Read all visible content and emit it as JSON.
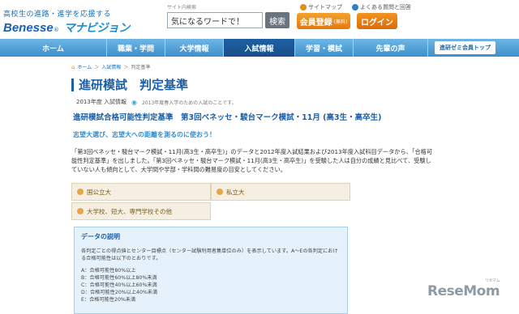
{
  "header": {
    "tagline": "高校生の進路・進学を応援する",
    "logo_benesse": "Benesse",
    "logo_reg": "®",
    "logo_manavi": "マナビジョン",
    "search_label": "サイト内検索",
    "search_value": "気になるワードで！",
    "search_button": "検索",
    "link_sitemap": "サイトマップ",
    "link_faq": "よくある質問と回答",
    "register_button": "会員登録",
    "register_note": "(無料)",
    "login_button": "ログイン"
  },
  "nav": {
    "items": [
      {
        "label": "ホーム"
      },
      {
        "label": "職業・学問"
      },
      {
        "label": "大学情報"
      },
      {
        "label": "入試情報"
      },
      {
        "label": "学習・模試"
      },
      {
        "label": "先輩の声"
      }
    ],
    "active_index": 3,
    "seminar_button": "進研ゼミ会員トップ"
  },
  "breadcrumb": {
    "home": "ホーム",
    "sep1": "＞",
    "section": "入試情報",
    "sep2": "＞",
    "current": "判定基準"
  },
  "page": {
    "title": "進研模試　判定基準",
    "year_label": "2013年度 入試情報",
    "year_note": "2013年度春入学のための入試のことです。",
    "main_heading": "進研模試合格可能性判定基準　第3回ベネッセ・駿台マーク模試・11月 (高3生・高卒生)",
    "catch": "志望大選び、志望大への距離を測るのに使おう！",
    "paragraph": "「第3回ベネッセ・駿台マーク模試・11月(高3生・高卒生)」のデータと2012年度入試結果および2013年度入試科目データから、「合格可能性判定基準」を出しました。「第3回ベネッセ・駿台マーク模試・11月(高3生・高卒生)」を受験した人は自分の成績と見比べて、受験していない人も傾向として、大学間や学部・学科間の難易度の目安としてください。"
  },
  "categories": [
    {
      "label": "国公立大"
    },
    {
      "label": "私立大"
    },
    {
      "label": "大学校、短大、専門学校その他"
    }
  ],
  "data_box": {
    "title": "データの説明",
    "description": "各判定ごとの得点値とセンター目標点（センター試験利用者集単位のみ）を表示しています。A〜Eの各判定における合格可能性は以下のとおりです。",
    "levels": [
      "A：合格可能性80%以上",
      "B：合格可能性60%以上80%未満",
      "C：合格可能性40%以上60%未満",
      "D：合格可能性20%以上40%未満",
      "E：合格可能性20%未満"
    ]
  },
  "watermark": {
    "text": "ReseMom",
    "small": "リセマム"
  },
  "colors": {
    "brand_blue": "#1b5fa6",
    "nav_blue": "#3d8fcb",
    "nav_active": "#1a4e8a",
    "accent_orange": "#e27a0d",
    "catch_blue": "#2e8fd2",
    "category_bg": "#f5efe1",
    "databox_bg": "#e6f2fb"
  }
}
